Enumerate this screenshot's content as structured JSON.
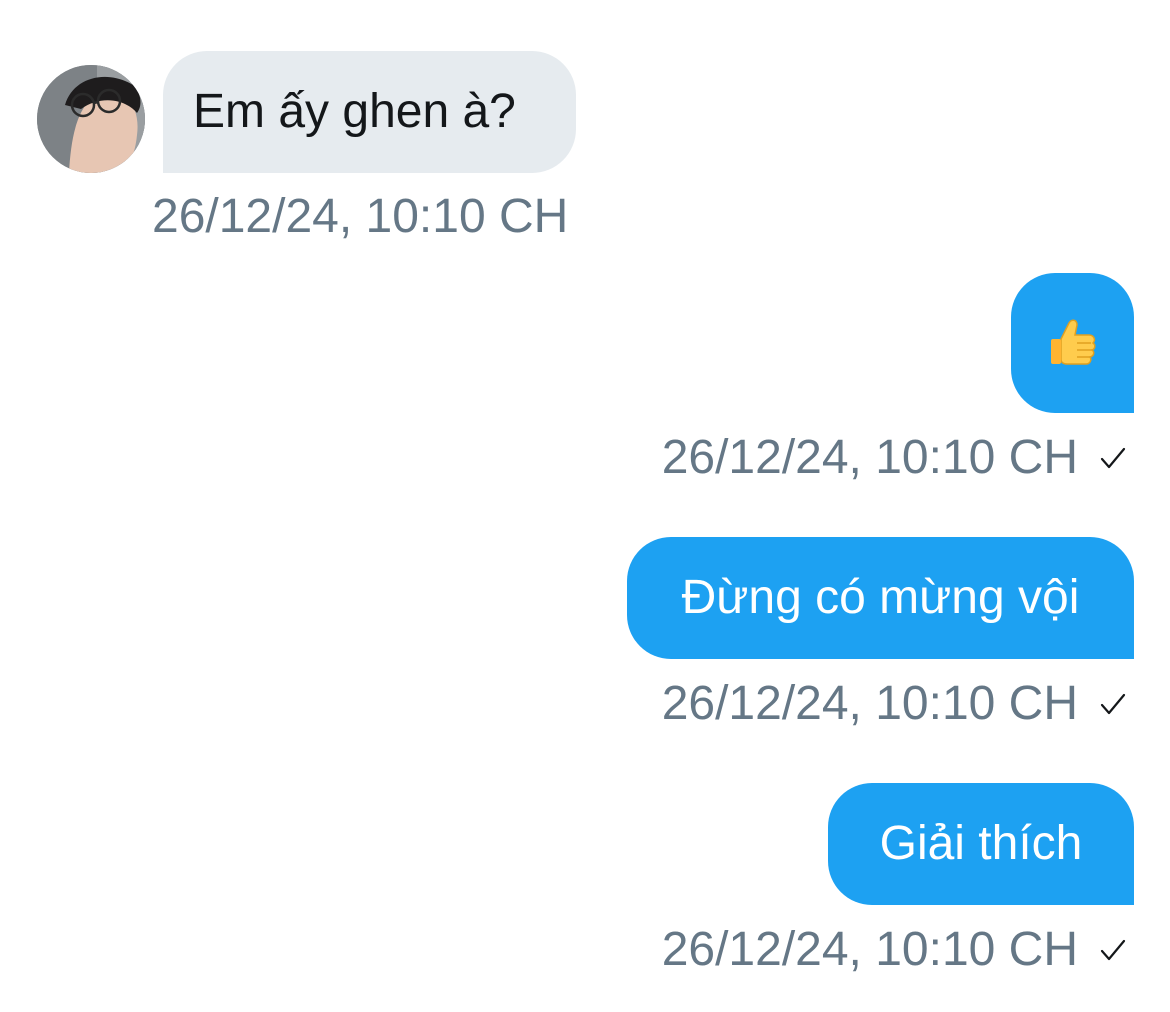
{
  "conversation": {
    "incoming": {
      "avatar_icon": "user-photo-avatar",
      "text": "Em ấy ghen à?",
      "timestamp": "26/12/24, 10:10 CH"
    },
    "outgoing": [
      {
        "type": "emoji",
        "icon": "thumbs-up-icon",
        "timestamp": "26/12/24, 10:10 CH",
        "status_icon": "checkmark-icon"
      },
      {
        "type": "text",
        "text": "Đừng có mừng vội",
        "timestamp": "26/12/24, 10:10 CH",
        "status_icon": "checkmark-icon"
      },
      {
        "type": "text",
        "text": "Giải thích",
        "timestamp": "26/12/24, 10:10 CH",
        "status_icon": "checkmark-icon"
      }
    ]
  },
  "colors": {
    "incoming_bubble": "#e6ebef",
    "outgoing_bubble": "#1da1f2",
    "timestamp": "#657786",
    "incoming_text": "#14171a"
  }
}
